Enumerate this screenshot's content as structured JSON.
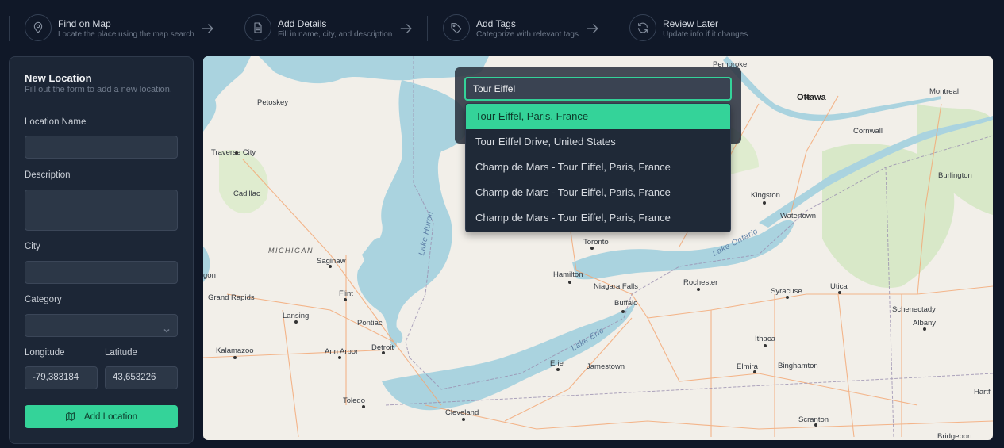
{
  "steps": [
    {
      "title": "Find on Map",
      "description": "Locate the place using the map search",
      "icon": "map-pin-icon"
    },
    {
      "title": "Add Details",
      "description": "Fill in name, city, and description",
      "icon": "document-icon"
    },
    {
      "title": "Add Tags",
      "description": "Categorize with relevant tags",
      "icon": "tag-icon"
    },
    {
      "title": "Review Later",
      "description": "Update info if it changes",
      "icon": "refresh-icon"
    }
  ],
  "form": {
    "title": "New Location",
    "subtitle": "Fill out the form to add a new location.",
    "name_label": "Location Name",
    "name_value": "",
    "description_label": "Description",
    "description_value": "",
    "city_label": "City",
    "city_value": "",
    "category_label": "Category",
    "category_value": "",
    "longitude_label": "Longitude",
    "longitude_value": "-79,383184",
    "latitude_label": "Latitude",
    "latitude_value": "43,653226",
    "submit_label": "Add Location"
  },
  "search": {
    "query": "Tour Eiffel",
    "results": [
      "Tour Eiffel, Paris, France",
      "Tour Eiffel Drive, United States",
      "Champ de Mars - Tour Eiffel, Paris, France",
      "Champ de Mars - Tour Eiffel, Paris, France",
      "Champ de Mars - Tour Eiffel, Paris, France"
    ],
    "active_index": 0
  },
  "map": {
    "places": {
      "pembroke": "Pembroke",
      "ottawa": "Ottawa",
      "montreal": "Montreal",
      "petoskey": "Petoskey",
      "cornwall": "Cornwall",
      "traverse_city": "Traverse City",
      "burlington": "Burlington",
      "cadillac": "Cadillac",
      "kingston": "Kingston",
      "watertown": "Watertown",
      "toronto": "Toronto",
      "michigan": "MICHIGAN",
      "saginaw": "Saginaw",
      "gon": "gon",
      "hamilton": "Hamilton",
      "niagara_falls": "Niagara Falls",
      "rochester": "Rochester",
      "grand_rapids": "Grand Rapids",
      "flint": "Flint",
      "buffalo": "Buffalo",
      "syracuse": "Syracuse",
      "utica": "Utica",
      "lansing": "Lansing",
      "pontiac": "Pontiac",
      "schenectady": "Schenectady",
      "albany": "Albany",
      "kalamazoo": "Kalamazoo",
      "ann_arbor": "Ann Arbor",
      "detroit": "Detroit",
      "ithaca": "Ithaca",
      "erie": "Erie",
      "jamestown": "Jamestown",
      "elmira": "Elmira",
      "binghamton": "Binghamton",
      "toledo": "Toledo",
      "hartf": "Hartf",
      "cleveland": "Cleveland",
      "scranton": "Scranton",
      "bridgeport": "Bridgeport"
    },
    "water": {
      "lake_huron": "Lake Huron",
      "lake_ontario": "Lake Ontario",
      "lake_erie": "Lake Erie"
    },
    "colors": {
      "land": "#f2efe9",
      "water": "#aad3df",
      "forest": "#d8e8c8",
      "road": "#f4a672"
    }
  }
}
